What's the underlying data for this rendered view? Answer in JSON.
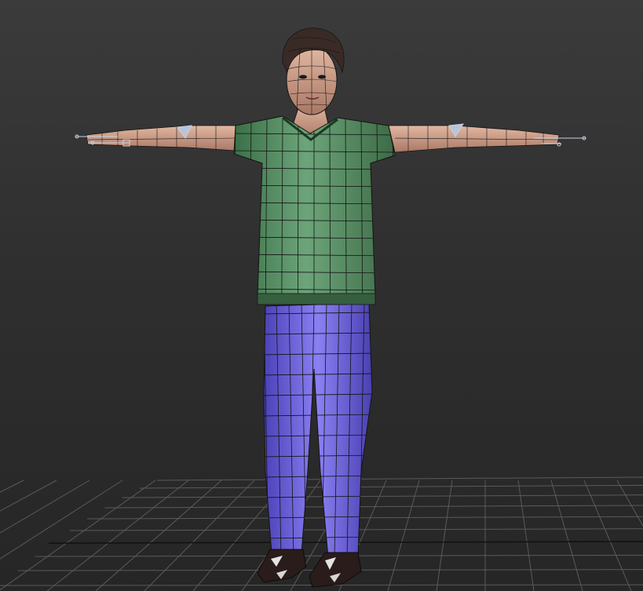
{
  "viewport": {
    "background_top": "#3b3b3b",
    "background_bottom": "#262626",
    "grid_color": "#5a5a5a",
    "grid_axis_color": "#111111"
  },
  "character": {
    "wireframe_color": "#141414",
    "shirt_color": "#4f8a5c",
    "pants_color": "#6a5fe0",
    "skin_color": "#c99880",
    "hair_color": "#3a2a26",
    "shoe_color": "#2a1c1a",
    "bone_color": "#b8c4d8"
  }
}
